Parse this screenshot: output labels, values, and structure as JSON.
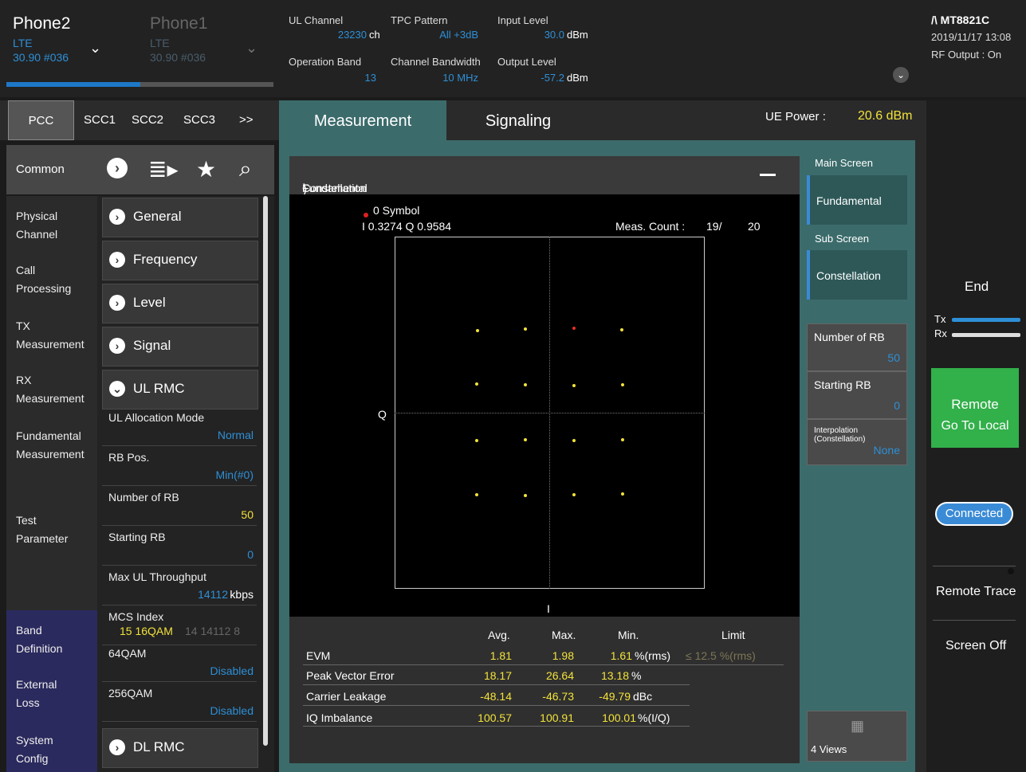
{
  "phones": [
    {
      "name": "Phone2",
      "tech": "LTE",
      "version": "30.90 #036"
    },
    {
      "name": "Phone1",
      "tech": "LTE",
      "version": "30.90 #036"
    }
  ],
  "info": {
    "ul_channel": {
      "label": "UL Channel",
      "value": "23230",
      "unit": "ch"
    },
    "tpc_pattern": {
      "label": "TPC Pattern",
      "value": "All +3dB"
    },
    "input_level": {
      "label": "Input Level",
      "value": "30.0",
      "unit": "dBm"
    },
    "operation_band": {
      "label": "Operation Band",
      "value": "13"
    },
    "channel_bandwidth": {
      "label": "Channel Bandwidth",
      "value": "10 MHz"
    },
    "output_level": {
      "label": "Output Level",
      "value": "-57.2",
      "unit": "dBm"
    }
  },
  "device": {
    "model": "MT8821C",
    "datetime": "2019/11/17 13:08",
    "rf_output": "RF Output : On"
  },
  "carrier_tabs": [
    "PCC",
    "SCC1",
    "SCC2",
    "SCC3",
    ">>"
  ],
  "common_label": "Common",
  "left_nav": [
    "Physical Channel",
    "Call Processing",
    "TX Measurement",
    "RX Measurement",
    "Fundamental Measurement",
    "Test Parameter"
  ],
  "left_nav_purple": [
    "Band Definition",
    "External Loss",
    "System Config"
  ],
  "sections": [
    "General",
    "Frequency",
    "Level",
    "Signal",
    "UL RMC",
    "DL RMC"
  ],
  "params": [
    {
      "k": "UL Allocation Mode",
      "v": "Normal"
    },
    {
      "k": "RB Pos.",
      "v": "Min(#0)"
    },
    {
      "k": "Number of RB",
      "v": "50"
    },
    {
      "k": "Starting RB",
      "v": "0"
    },
    {
      "k": "Max UL Throughput",
      "v": "14112",
      "unit": "kbps"
    },
    {
      "k": "MCS Index",
      "v": "15 16QAM",
      "v2": "14 14112 8"
    },
    {
      "k": "64QAM",
      "v": "Disabled"
    },
    {
      "k": "256QAM",
      "v": "Disabled"
    }
  ],
  "main_tabs": {
    "measurement": "Measurement",
    "signaling": "Signaling"
  },
  "ue_power": {
    "label": "UE Power :",
    "value": "20.6 dBm"
  },
  "breadcrumb": {
    "a": "Fundamental",
    "b": "Constellation"
  },
  "plot": {
    "symbol": "0 Symbol",
    "iq": "I 0.3274 Q 0.9584",
    "meas_count_label": "Meas. Count :",
    "meas_count": "19/",
    "meas_total": "20",
    "q_label": "Q",
    "i_label": "I"
  },
  "table": {
    "headers": [
      "Avg.",
      "Max.",
      "Min.",
      "Limit"
    ],
    "rows": [
      {
        "name": "EVM",
        "avg": "1.81",
        "max": "1.98",
        "min": "1.61",
        "unit": "%(rms)",
        "limit": "≤ 12.5 %(rms)"
      },
      {
        "name": "Peak Vector Error",
        "avg": "18.17",
        "max": "26.64",
        "min": "13.18",
        "unit": "%",
        "limit": ""
      },
      {
        "name": "Carrier Leakage",
        "avg": "-48.14",
        "max": "-46.73",
        "min": "-49.79",
        "unit": "dBc",
        "limit": ""
      },
      {
        "name": "IQ Imbalance",
        "avg": "100.57",
        "max": "100.91",
        "min": "100.01",
        "unit": "%(I/Q)",
        "limit": ""
      }
    ]
  },
  "side": {
    "main_screen": "Main Screen",
    "main_btn": "Fundamental",
    "sub_screen": "Sub Screen",
    "sub_btn": "Constellation",
    "num_rb": "Number of RB",
    "num_rb_v": "50",
    "start_rb": "Starting RB",
    "start_rb_v": "0",
    "interp": "Interpolation (Constellation)",
    "interp_v": "None",
    "views": "4 Views"
  },
  "right": {
    "end": "End",
    "tx": "Tx",
    "rx": "Rx",
    "remote": "Remote",
    "go_local": "Go To Local",
    "connected": "Connected",
    "remote_trace": "Remote Trace",
    "screen_off": "Screen Off"
  }
}
